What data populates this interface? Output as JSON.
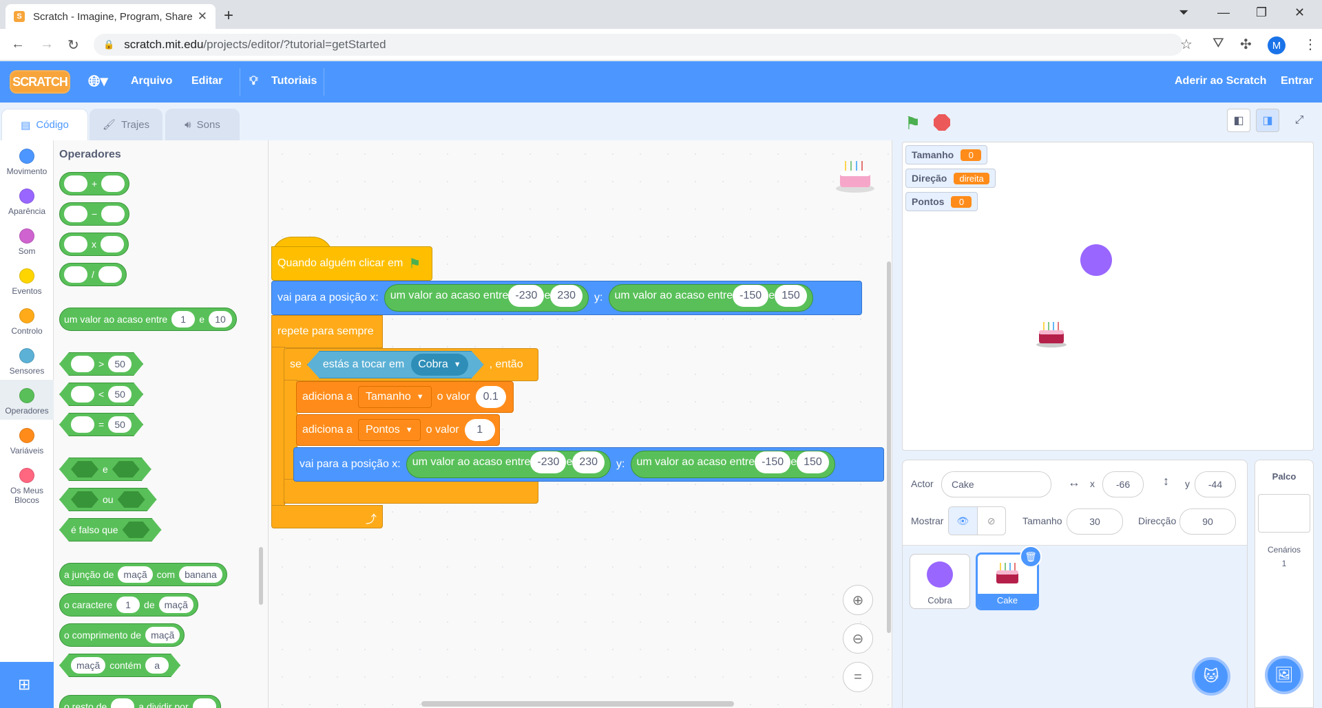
{
  "browser": {
    "tab_title": "Scratch - Imagine, Program, Share",
    "tab_favicon": "S",
    "url_host": "scratch.mit.edu",
    "url_path": "/projects/editor/?tutorial=getStarted",
    "profile_initial": "M"
  },
  "menu": {
    "logo": "SCRATCH",
    "file": "Arquivo",
    "edit": "Editar",
    "tutorials": "Tutoriais",
    "join": "Aderir ao Scratch",
    "signin": "Entrar"
  },
  "editor_tabs": {
    "code": "Código",
    "costumes": "Trajes",
    "sounds": "Sons"
  },
  "categories": [
    {
      "label": "Movimento",
      "color": "#4c97ff"
    },
    {
      "label": "Aparência",
      "color": "#9966ff"
    },
    {
      "label": "Som",
      "color": "#cf63cf"
    },
    {
      "label": "Eventos",
      "color": "#ffd500"
    },
    {
      "label": "Controlo",
      "color": "#ffab19"
    },
    {
      "label": "Sensores",
      "color": "#5cb1d6"
    },
    {
      "label": "Operadores",
      "color": "#59c059"
    },
    {
      "label": "Variáveis",
      "color": "#ff8c1a"
    },
    {
      "label": "Os Meus Blocos",
      "color": "#ff6680"
    }
  ],
  "palette": {
    "title": "Operadores",
    "ops": [
      "+",
      "−",
      "x",
      "/"
    ],
    "random": {
      "label": "um valor ao acaso entre",
      "a": "1",
      "and": "e",
      "b": "10"
    },
    "compare": [
      {
        "op": ">",
        "v": "50"
      },
      {
        "op": "<",
        "v": "50"
      },
      {
        "op": "=",
        "v": "50"
      }
    ],
    "and": "e",
    "or": "ou",
    "not": "é falso que",
    "join": {
      "label": "a junção de",
      "a": "maçã",
      "with": "com",
      "b": "banana"
    },
    "letter": {
      "label": "o caractere",
      "n": "1",
      "of": "de",
      "s": "maçã"
    },
    "length": {
      "label": "o comprimento de",
      "s": "maçã"
    },
    "contains": {
      "s": "maçã",
      "label": "contém",
      "t": "a"
    },
    "mod": {
      "label": "o resto de",
      "by": "a dividir por"
    }
  },
  "script": {
    "hat": "Quando alguém clicar em",
    "goto_label": "vai para a posição x:",
    "random_label": "um valor ao acaso entre",
    "and": "e",
    "y_label": "y:",
    "x_min": "-230",
    "x_max": "230",
    "y_min": "-150",
    "y_max": "150",
    "forever": "repete para sempre",
    "if": "se",
    "touching": "estás a tocar em",
    "touch_target": "Cobra",
    "then": ", então",
    "change1": {
      "label": "adiciona a",
      "var": "Tamanho",
      "by": "o valor",
      "val": "0.1"
    },
    "change2": {
      "label": "adiciona a",
      "var": "Pontos",
      "by": "o valor",
      "val": "1"
    }
  },
  "monitors": [
    {
      "name": "Tamanho",
      "value": "0"
    },
    {
      "name": "Direção",
      "value": "direita"
    },
    {
      "name": "Pontos",
      "value": "0"
    }
  ],
  "sprite_info": {
    "actor_label": "Actor",
    "actor_name": "Cake",
    "x_label": "x",
    "x": "-66",
    "y_label": "y",
    "y": "-44",
    "show_label": "Mostrar",
    "size_label": "Tamanho",
    "size": "30",
    "dir_label": "Direcção",
    "dir": "90"
  },
  "sprites": [
    {
      "name": "Cobra",
      "color": "#9966ff"
    },
    {
      "name": "Cake",
      "color": "#e05a7a"
    }
  ],
  "stage_panel": {
    "title": "Palco",
    "backdrops_label": "Cenários",
    "backdrops_count": "1"
  }
}
